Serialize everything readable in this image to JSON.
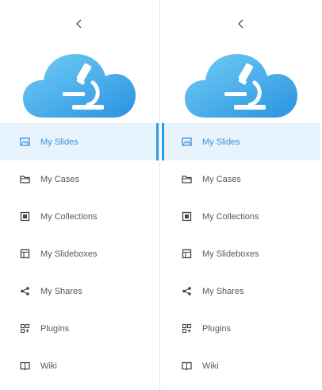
{
  "colors": {
    "accent": "#2a9be8",
    "active_bg": "#e8f4fd",
    "active_text": "#3b8fd6",
    "text": "#555a60",
    "logo_light": "#63c3f3",
    "logo_dark": "#2e9ae3"
  },
  "collapse_icon": "chevron-left-icon",
  "logo_icon": "cloud-microscope-icon",
  "panels": [
    {
      "nav": [
        {
          "label": "My Slides",
          "icon": "image-icon",
          "active": true
        },
        {
          "label": "My Cases",
          "icon": "folder-icon"
        },
        {
          "label": "My Collections",
          "icon": "collection-icon"
        },
        {
          "label": "My Slideboxes",
          "icon": "slidebox-icon"
        },
        {
          "label": "My Shares",
          "icon": "share-icon"
        },
        {
          "label": "Plugins",
          "icon": "plugin-icon"
        },
        {
          "label": "Wiki",
          "icon": "book-icon"
        }
      ]
    },
    {
      "nav": [
        {
          "label": "My Slides",
          "icon": "image-icon",
          "active": true
        },
        {
          "label": "My Cases",
          "icon": "folder-icon"
        },
        {
          "label": "My Collections",
          "icon": "collection-icon"
        },
        {
          "label": "My Slideboxes",
          "icon": "slidebox-icon"
        },
        {
          "label": "My Shares",
          "icon": "share-icon"
        },
        {
          "label": "Plugins",
          "icon": "plugin-icon"
        },
        {
          "label": "Wiki",
          "icon": "book-icon"
        }
      ]
    }
  ]
}
